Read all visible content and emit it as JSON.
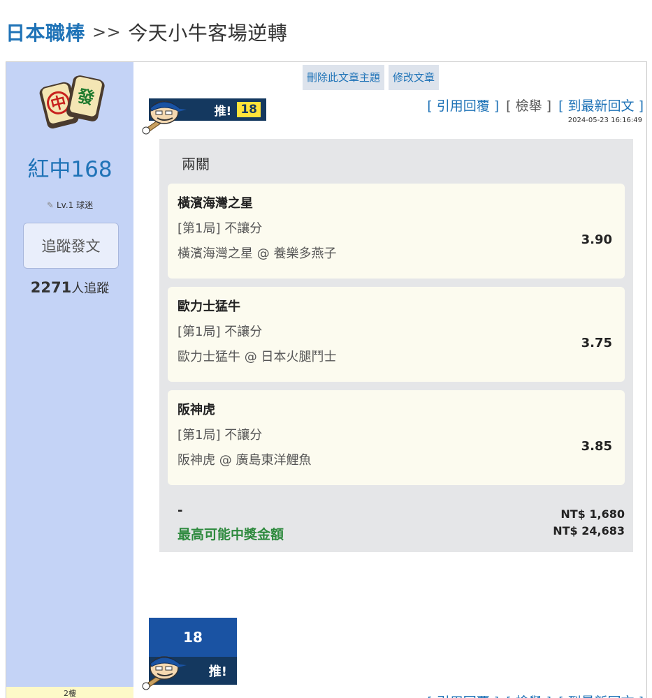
{
  "header": {
    "crumb": "日本職棒",
    "separator": ">>",
    "topic": "今天小牛客場逆轉"
  },
  "author": {
    "name": "紅中168",
    "level": "Lv.1 球迷",
    "follow_label": "追蹤發文",
    "followers_count": "2271",
    "followers_suffix": "人追蹤"
  },
  "admin": {
    "delete_label": "刪除此文章主題",
    "edit_label": "修改文章"
  },
  "push": {
    "label": "推!",
    "count": "18"
  },
  "actions": {
    "quote_label": "引用回覆",
    "report_label": "檢舉",
    "latest_label": "到最新回文",
    "separator": "]  ["
  },
  "post": {
    "timestamp": "2024-05-23 16:16:49"
  },
  "bet": {
    "type": "兩關",
    "selections": [
      {
        "team": "橫濱海灣之星",
        "market": "[第1局] 不讓分",
        "match": "橫濱海灣之星 @ 養樂多燕子",
        "odds": "3.90"
      },
      {
        "team": "歐力士猛牛",
        "market": "[第1局] 不讓分",
        "match": "歐力士猛牛 @ 日本火腿鬥士",
        "odds": "3.75"
      },
      {
        "team": "阪神虎",
        "market": "[第1局] 不讓分",
        "match": "阪神虎 @ 廣島東洋鯉魚",
        "odds": "3.85"
      }
    ],
    "dash": "-",
    "max_payout_label": "最高可能中獎金額",
    "stake": "NT$ 1,680",
    "max_payout": "NT$ 24,683"
  },
  "next_post": {
    "floor": "2樓"
  },
  "colors": {
    "link_blue": "#1f73b7",
    "sidebar_bg": "#c4d3f6",
    "push_navy": "#14385f",
    "push_yellow": "#ffe33a",
    "payout_green": "#2e8a3e"
  }
}
